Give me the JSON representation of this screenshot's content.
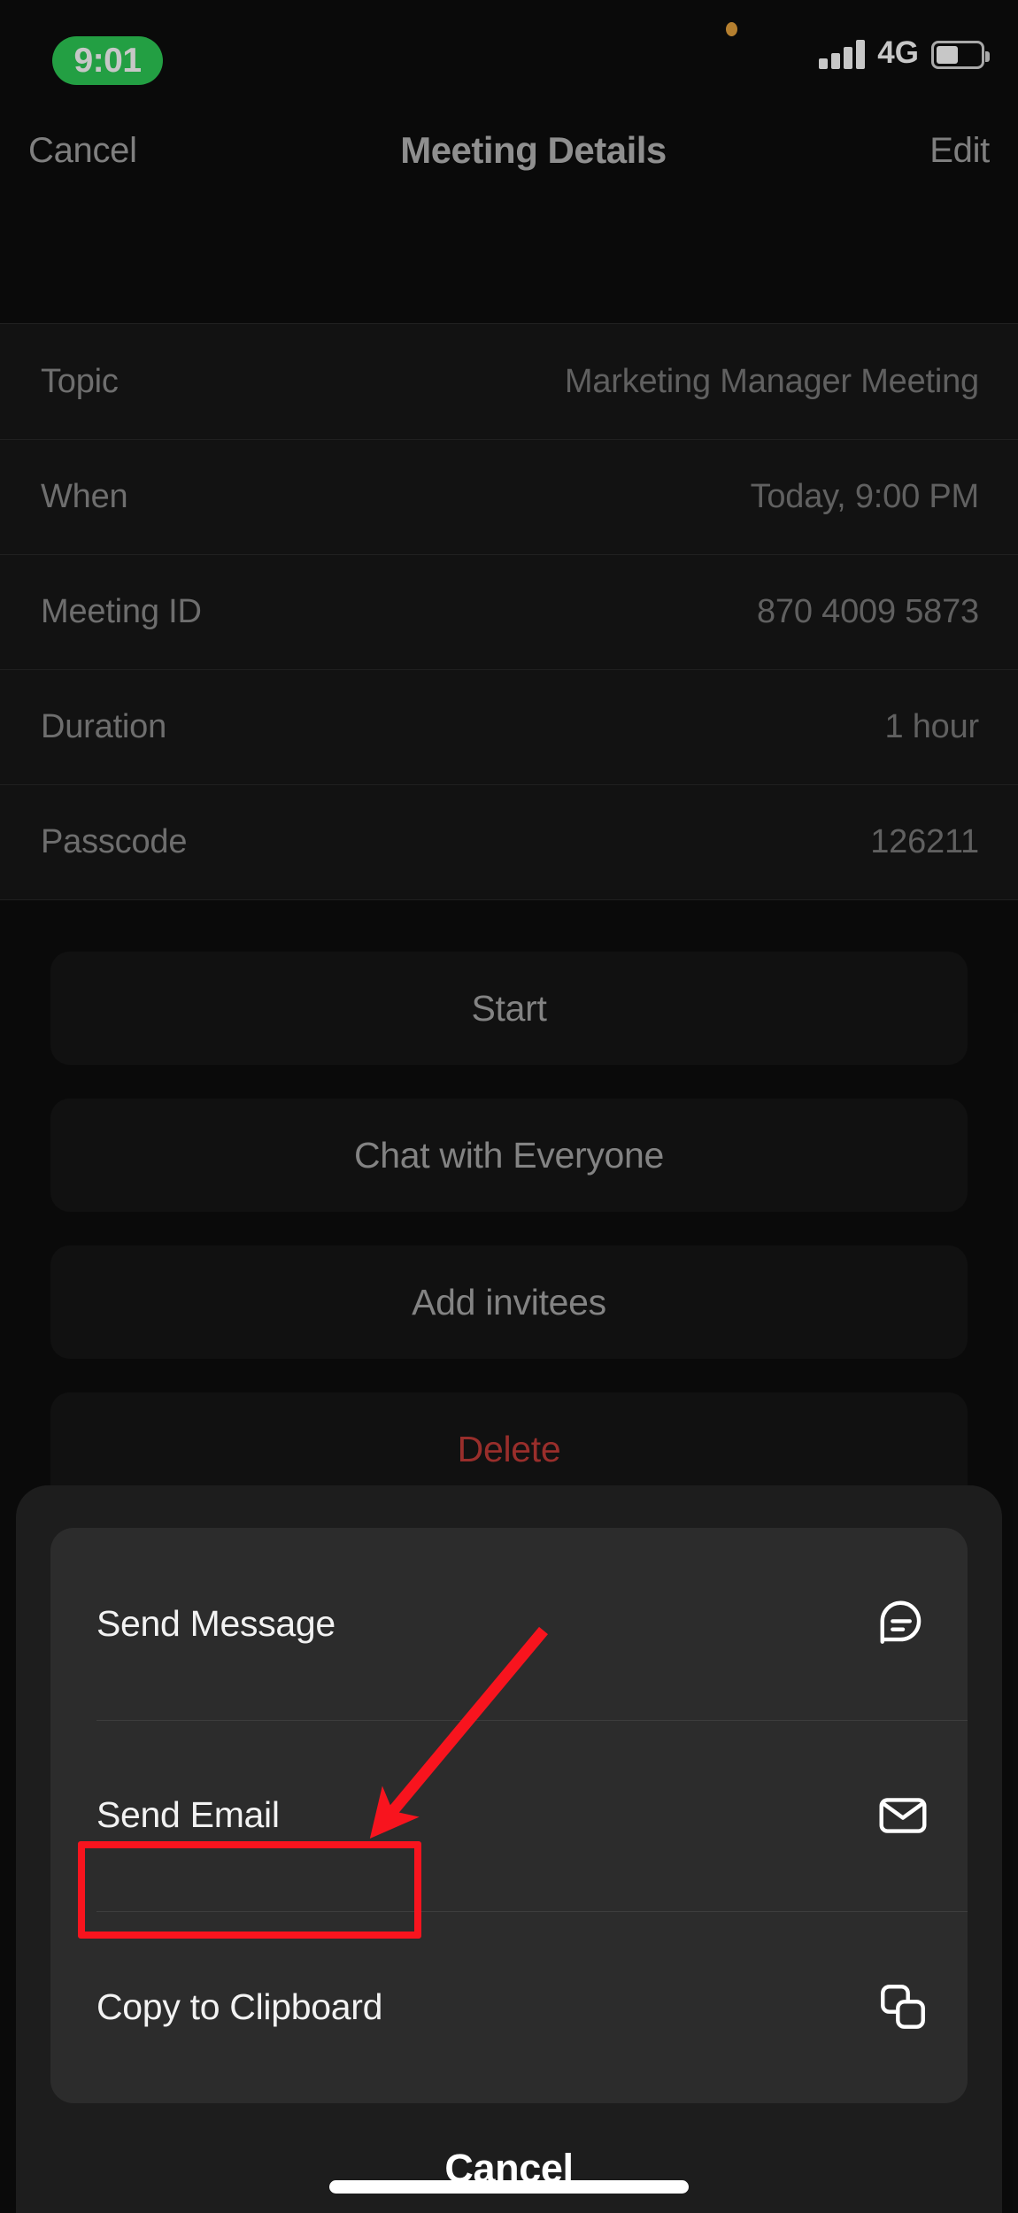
{
  "status_bar": {
    "time": "9:01",
    "network": "4G",
    "signal_icon": "cellular-bars-icon",
    "battery_icon": "battery-icon",
    "recording_dot_icon": "orange-privacy-dot-icon",
    "accent_green": "#2ecc56"
  },
  "nav_bar": {
    "left_label": "Cancel",
    "title": "Meeting Details",
    "right_label": "Edit"
  },
  "details": {
    "rows": [
      {
        "label": "Topic",
        "value": "Marketing Manager Meeting"
      },
      {
        "label": "When",
        "value": "Today, 9:00 PM"
      },
      {
        "label": "Meeting ID",
        "value": "870 4009 5873"
      },
      {
        "label": "Duration",
        "value": "1 hour"
      },
      {
        "label": "Passcode",
        "value": "126211"
      }
    ]
  },
  "actions": {
    "buttons": [
      {
        "label": "Start",
        "style": "normal"
      },
      {
        "label": "Chat with Everyone",
        "style": "normal"
      },
      {
        "label": "Add invitees",
        "style": "normal"
      },
      {
        "label": "Delete",
        "style": "danger"
      }
    ],
    "danger_color": "#c43c38"
  },
  "action_sheet": {
    "items": [
      {
        "label": "Send Message",
        "icon": "message-bubble-icon"
      },
      {
        "label": "Send Email",
        "icon": "envelope-icon"
      },
      {
        "label": "Copy to Clipboard",
        "icon": "copy-icon"
      }
    ],
    "cancel_label": "Cancel"
  },
  "annotation": {
    "color": "#f8141e",
    "highlight_target": "Copy to Clipboard",
    "arrow_icon": "red-arrow-icon",
    "box_icon": "red-highlight-box-icon"
  }
}
